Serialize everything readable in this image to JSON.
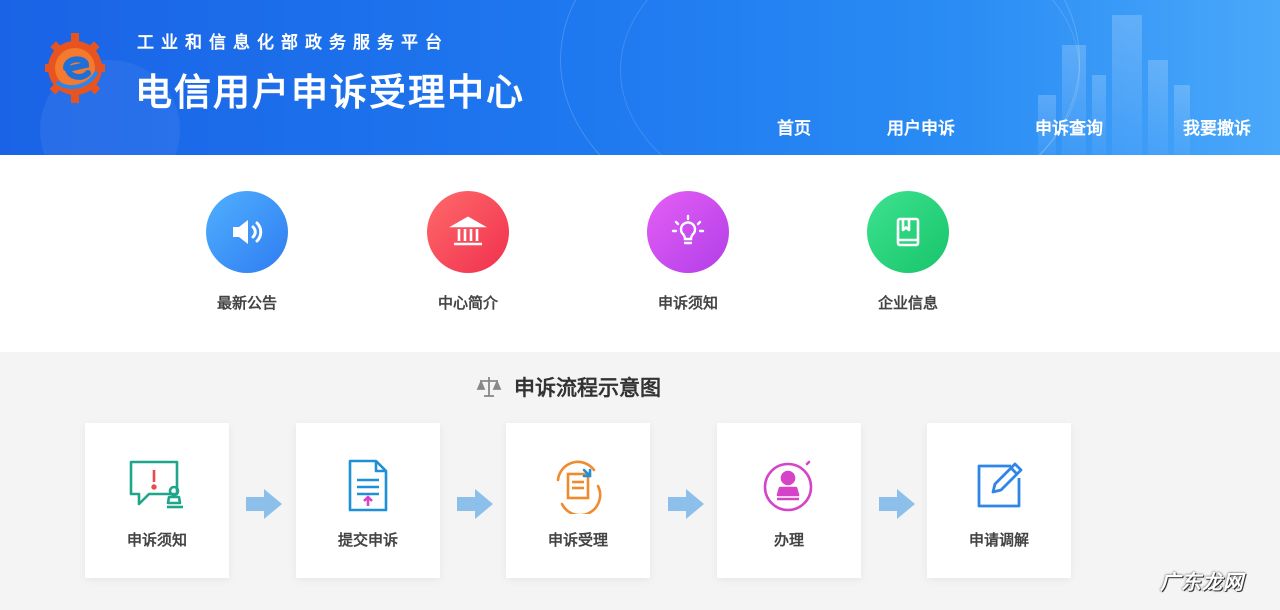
{
  "header": {
    "subtitle": "工业和信息化部政务服务平台",
    "title": "电信用户申诉受理中心",
    "logo_icon": "gear-e-logo"
  },
  "nav": [
    {
      "label": "首页"
    },
    {
      "label": "用户申诉"
    },
    {
      "label": "申诉查询"
    },
    {
      "label": "我要撤诉"
    }
  ],
  "quick_links": [
    {
      "label": "最新公告",
      "icon": "speaker-icon",
      "color": "#3a8ef5"
    },
    {
      "label": "中心简介",
      "icon": "building-icon",
      "color": "#f23b55"
    },
    {
      "label": "申诉须知",
      "icon": "lightbulb-icon",
      "color": "#c84ef0"
    },
    {
      "label": "企业信息",
      "icon": "book-icon",
      "color": "#22d07a"
    }
  ],
  "flow": {
    "title": "申诉流程示意图",
    "title_icon": "scale-icon",
    "steps": [
      {
        "label": "申诉须知",
        "icon": "notice-chat-icon"
      },
      {
        "label": "提交申诉",
        "icon": "document-upload-icon"
      },
      {
        "label": "申诉受理",
        "icon": "accept-document-icon"
      },
      {
        "label": "办理",
        "icon": "stamp-icon"
      },
      {
        "label": "申请调解",
        "icon": "edit-icon"
      }
    ]
  },
  "watermark": "广东龙网"
}
